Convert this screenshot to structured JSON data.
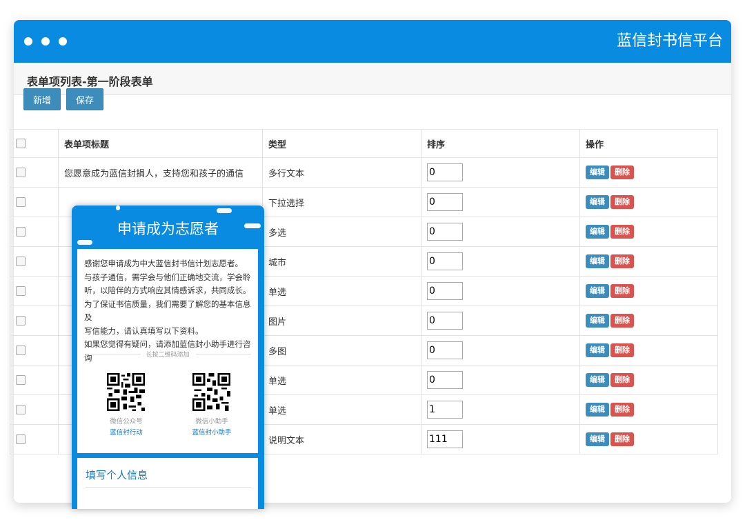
{
  "app": {
    "brand": "蓝信封书信平台"
  },
  "page": {
    "title": "表单项列表-第一阶段表单"
  },
  "toolbar": {
    "add_label": "新增",
    "save_label": "保存"
  },
  "table": {
    "headers": {
      "title": "表单项标题",
      "type": "类型",
      "sort": "排序",
      "ops": "操作"
    },
    "edit_label": "编辑",
    "delete_label": "删除",
    "rows": [
      {
        "title": "您愿意成为蓝信封捐人，支持您和孩子的通信",
        "type": "多行文本",
        "sort": "0"
      },
      {
        "title": "",
        "type": "下拉选择",
        "sort": "0"
      },
      {
        "title": "",
        "type": "多选",
        "sort": "0"
      },
      {
        "title": "",
        "type": "城市",
        "sort": "0"
      },
      {
        "title": "",
        "type": "单选",
        "sort": "0"
      },
      {
        "title": "",
        "type": "图片",
        "sort": "0"
      },
      {
        "title": "",
        "type": "多图",
        "sort": "0"
      },
      {
        "title": "",
        "type": "单选",
        "sort": "0"
      },
      {
        "title": "",
        "type": "单选",
        "sort": "1"
      },
      {
        "title": "",
        "type": "说明文本",
        "sort": "111"
      }
    ]
  },
  "preview": {
    "title": "申请成为志愿者",
    "intro_lines": [
      "感谢您申请成为中大蓝信封书信计划志愿者。",
      "与孩子通信，需学会与他们正确地交流，学会聆",
      "听，以陪伴的方式响应其情感诉求，共同成长。",
      "为了保证书信质量，我们需要了解您的基本信息及",
      "写信能力，请认真填写以下资料。",
      "如果您觉得有疑问，请添加蓝信封小助手进行咨询"
    ],
    "qr_hint": "长按二维码添加",
    "qr": [
      {
        "caption": "微信公众号",
        "name": "蓝信封行动"
      },
      {
        "caption": "微信小助手",
        "name": "蓝信封小助手"
      }
    ],
    "section_title": "填写个人信息"
  },
  "colors": {
    "header_blue": "#0a8be2",
    "button_blue": "#3c8dbc",
    "delete_red": "#d9534f"
  }
}
